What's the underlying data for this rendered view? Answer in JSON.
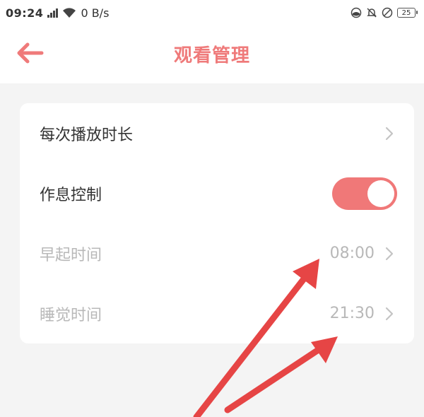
{
  "status_bar": {
    "time": "09:24",
    "network_speed": "0 B/s",
    "battery_level": "25",
    "icons": [
      "signal-icon",
      "wifi-icon",
      "app-notification-icon",
      "mute-bell-icon",
      "no-sim-icon",
      "battery-icon"
    ]
  },
  "header": {
    "title": "观看管理",
    "back_icon": "arrow-left-icon"
  },
  "settings": {
    "play_duration": {
      "label": "每次播放时长"
    },
    "rest_control": {
      "label": "作息控制",
      "enabled": true
    },
    "wake_time": {
      "label": "早起时间",
      "value": "08:00"
    },
    "sleep_time": {
      "label": "睡觉时间",
      "value": "21:30"
    }
  },
  "colors": {
    "accent": "#f07878",
    "title": "#ef7a7a",
    "disabled_text": "#b8b8b8",
    "primary_text": "#333333",
    "background": "#f4f4f4",
    "annotation_arrow": "#e64545"
  }
}
